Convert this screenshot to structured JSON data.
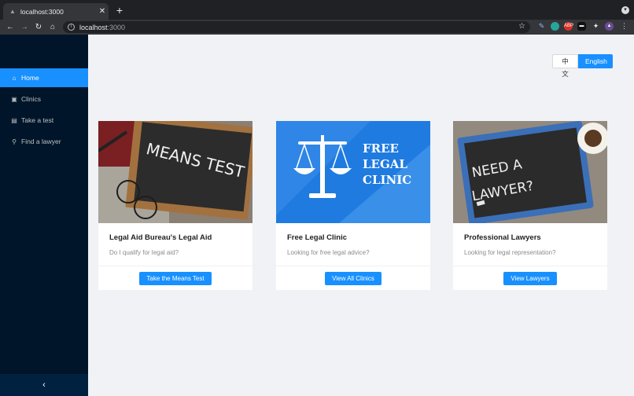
{
  "browser": {
    "tab_title": "localhost:3000",
    "url_host": "localhost",
    "url_port": ":3000"
  },
  "sidebar": {
    "items": [
      {
        "label": "Home",
        "icon": "home-icon",
        "active": true
      },
      {
        "label": "Clinics",
        "icon": "clinic-icon",
        "active": false
      },
      {
        "label": "Take a test",
        "icon": "test-icon",
        "active": false
      },
      {
        "label": "Find a lawyer",
        "icon": "search-icon",
        "active": false
      }
    ],
    "collapse_glyph": "‹"
  },
  "language": {
    "zh_label": "中文",
    "en_label": "English",
    "selected": "English"
  },
  "cards": [
    {
      "image_text": "MEANS TEST",
      "title": "Legal Aid Bureau's Legal Aid",
      "description": "Do I qualify for legal aid?",
      "button": "Take the Means Test"
    },
    {
      "image_text_lines": [
        "FREE",
        "LEGAL",
        "CLINIC"
      ],
      "title": "Free Legal Clinic",
      "description": "Looking for free legal advice?",
      "button": "View All Clinics"
    },
    {
      "image_text_lines": [
        "NEED A",
        "LAWYER?"
      ],
      "title": "Professional Lawyers",
      "description": "Looking for legal representation?",
      "button": "View Lawyers"
    }
  ],
  "colors": {
    "primary": "#1890ff",
    "sidebar_bg": "#001529",
    "page_bg": "#f0f2f5"
  }
}
